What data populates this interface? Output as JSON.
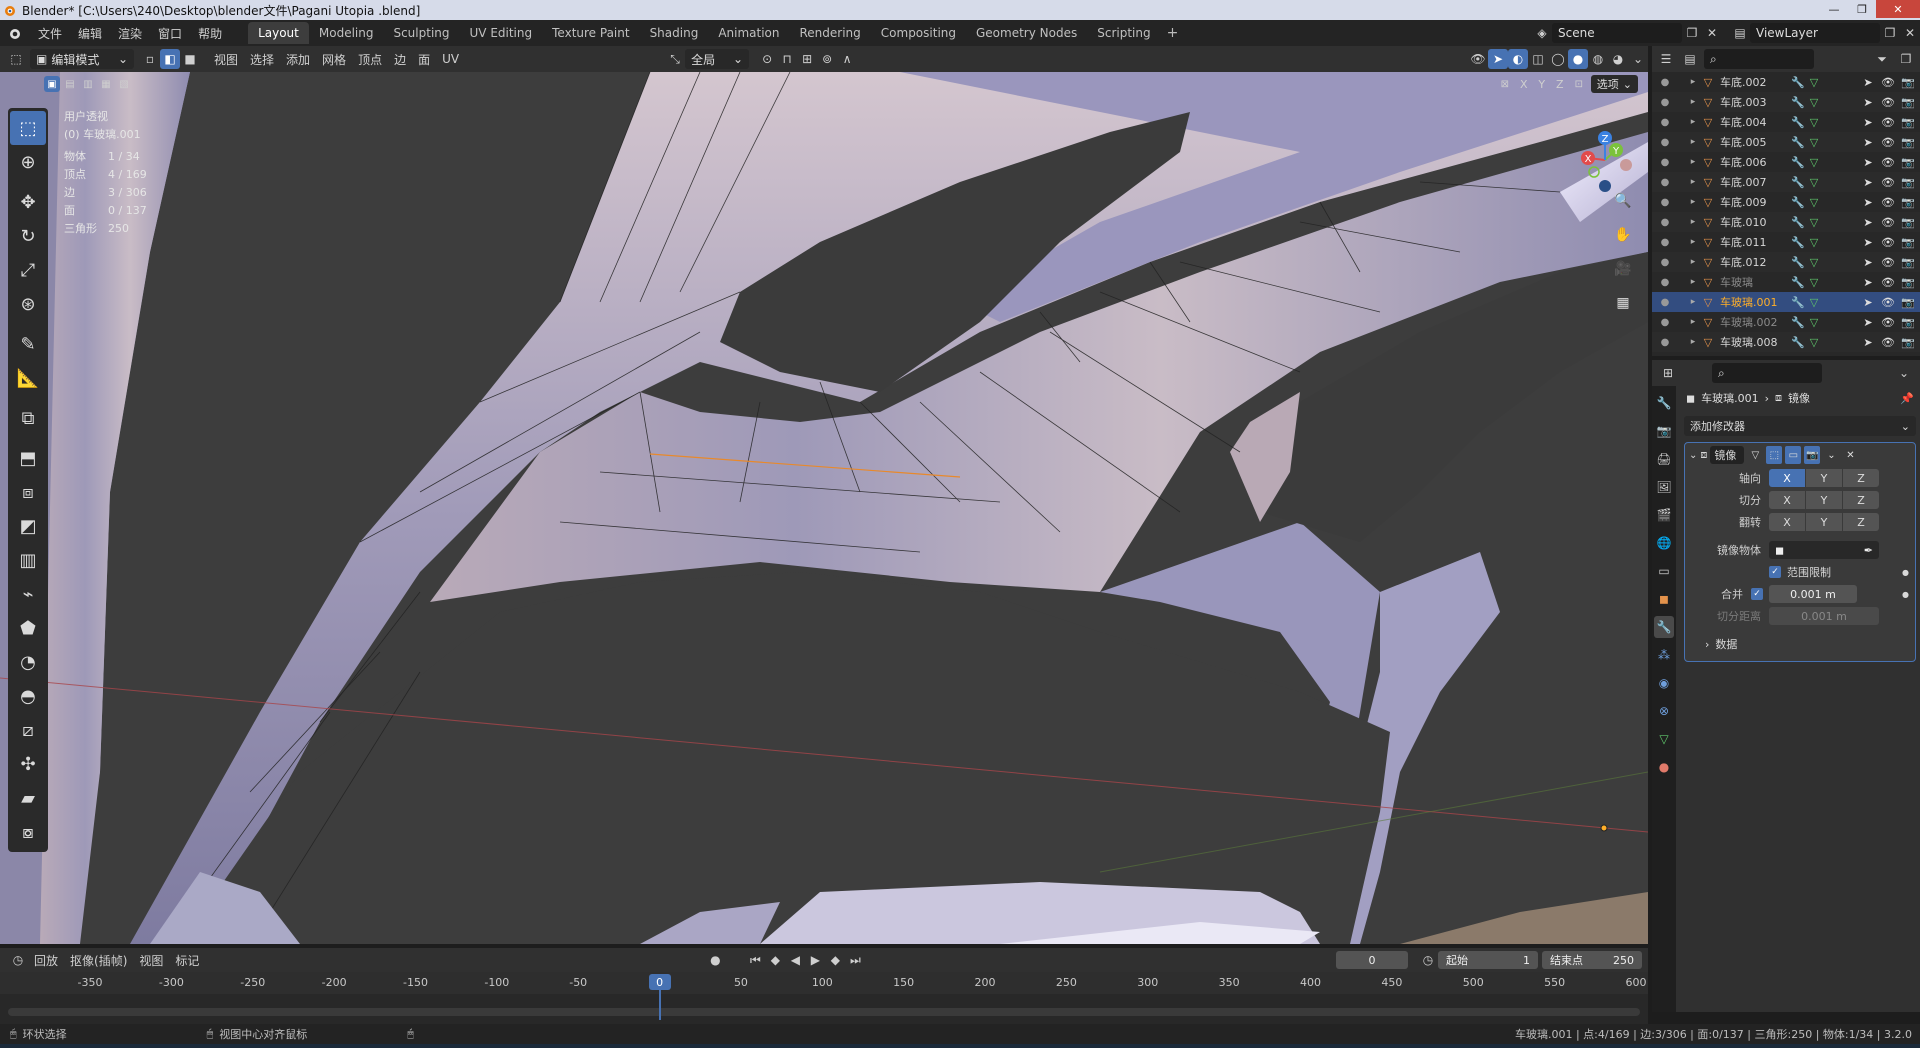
{
  "window": {
    "title": "Blender* [C:\\Users\\240\\Desktop\\blender文件\\Pagani Utopia .blend]"
  },
  "topbar": {
    "menus": [
      "文件",
      "编辑",
      "渲染",
      "窗口",
      "帮助"
    ],
    "workspaces": [
      "Layout",
      "Modeling",
      "Sculpting",
      "UV Editing",
      "Texture Paint",
      "Shading",
      "Animation",
      "Rendering",
      "Compositing",
      "Geometry Nodes",
      "Scripting"
    ],
    "active_workspace": "Layout",
    "add_tab": "+",
    "scene": "Scene",
    "view_layer": "ViewLayer"
  },
  "viewport_header": {
    "mode": "编辑模式",
    "menus": [
      "视图",
      "选择",
      "添加",
      "网格",
      "顶点",
      "边",
      "面",
      "UV"
    ],
    "transform_orientation": "全局",
    "options_label": "选项",
    "axes": [
      "X",
      "Y",
      "Z"
    ]
  },
  "viewport_overlay": {
    "view_name": "用户透视",
    "object_name": "(0) 车玻璃.001",
    "stats": [
      {
        "label": "物体",
        "value": "1 / 34"
      },
      {
        "label": "顶点",
        "value": "4 / 169"
      },
      {
        "label": "边",
        "value": "3 / 306"
      },
      {
        "label": "面",
        "value": "0 / 137"
      },
      {
        "label": "三角形",
        "value": "250"
      }
    ]
  },
  "gizmo": {
    "x": "X",
    "y": "Y",
    "z": "Z",
    "colors": {
      "x": "#e24b4b",
      "y": "#7bc23b",
      "z": "#3b82e2"
    }
  },
  "outliner": {
    "items": [
      {
        "label": "车底.002",
        "state": "normal"
      },
      {
        "label": "车底.003",
        "state": "normal"
      },
      {
        "label": "车底.004",
        "state": "normal"
      },
      {
        "label": "车底.005",
        "state": "normal"
      },
      {
        "label": "车底.006",
        "state": "normal"
      },
      {
        "label": "车底.007",
        "state": "normal"
      },
      {
        "label": "车底.009",
        "state": "normal"
      },
      {
        "label": "车底.010",
        "state": "normal"
      },
      {
        "label": "车底.011",
        "state": "normal"
      },
      {
        "label": "车底.012",
        "state": "normal"
      },
      {
        "label": "车玻璃",
        "state": "dim"
      },
      {
        "label": "车玻璃.001",
        "state": "active"
      },
      {
        "label": "车玻璃.002",
        "state": "dim"
      },
      {
        "label": "车玻璃.008",
        "state": "normal"
      }
    ]
  },
  "properties": {
    "breadcrumb_object": "车玻璃.001",
    "breadcrumb_modifier": "镜像",
    "add_modifier": "添加修改器",
    "modifier_name": "镜像",
    "rows": {
      "axis": "轴向",
      "bisect": "切分",
      "flip": "翻转",
      "mirror_object": "镜像物体",
      "clipping": "范围限制",
      "merge": "合并",
      "merge_value": "0.001 m",
      "bisect_distance": "切分距离",
      "bisect_distance_value": "0.001 m",
      "data": "数据"
    },
    "axis_x_on": true
  },
  "timeline": {
    "menus": [
      "回放",
      "抠像(插帧)",
      "视图",
      "标记"
    ],
    "current_frame": "0",
    "start_label": "起始",
    "start": "1",
    "end_label": "结束点",
    "end": "250",
    "ticks": [
      "-350",
      "-300",
      "-250",
      "-200",
      "-150",
      "-100",
      "-50",
      "0",
      "50",
      "100",
      "150",
      "200",
      "250",
      "300",
      "350",
      "400",
      "450",
      "500",
      "550",
      "600"
    ],
    "playhead": "0"
  },
  "statusbar": {
    "left": "环状选择",
    "middle": "视图中心对齐鼠标",
    "right": "车玻璃.001 | 点:4/169 | 边:3/306 | 面:0/137 | 三角形:250 | 物体:1/34 | 3.2.0"
  },
  "colors": {
    "accent": "#4772b3",
    "active_object": "#ffaf29",
    "viewport_bg": "#3d3d3d"
  }
}
